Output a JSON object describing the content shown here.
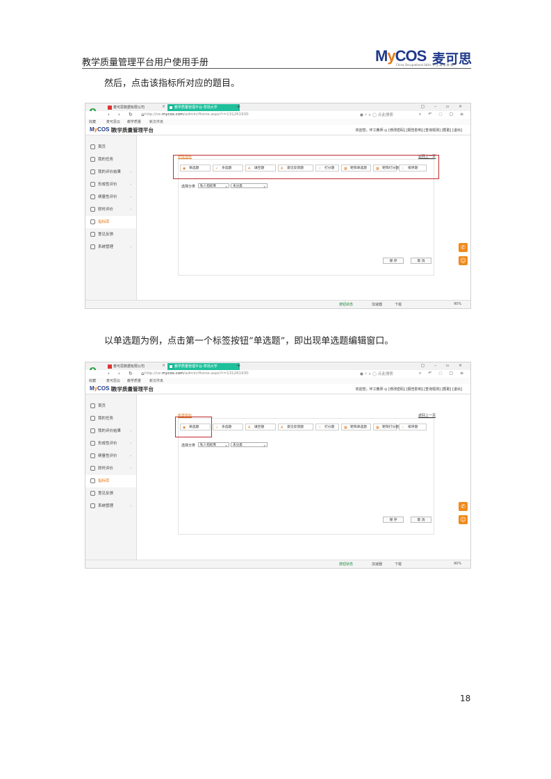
{
  "header": {
    "doc_title": "教学质量管理平台用户使用手册",
    "logo_mark": "MyCOS",
    "logo_cn": "麦可思",
    "logo_sub": "China Occupational Skills  专 注 高 等 教 育"
  },
  "para1": "然后，点击该指标所对应的题目。",
  "para2": "以单选题为例，点击第一个标签按钮“单选题”，即出现单选题编辑窗口。",
  "page_number": "18",
  "browser": {
    "tab1": "麦可思数据有限公司",
    "tab2": "教学质量管理平台-草场大学",
    "url_prefix": "http://ce.",
    "url_domain": "mycos.com",
    "url_path": "/admin/Home.aspx?r=131261930",
    "search_placeholder": "点此搜索",
    "fav_items": [
      "收藏",
      "麦可思云",
      "教学质量",
      "新文件夹"
    ],
    "app_logo": "MyCOS",
    "app_name": "教学质量管理平台",
    "user_links": "欢迎您，环工教师  ◎   [修改密码]  [报告影响]  [查询观测]  [帮助]  [退出]",
    "sidebar": [
      "首页",
      "我的任务",
      "我的评价结果",
      "形成性评价",
      "绩量性评价",
      "即时评价",
      "指标库",
      "意见反馈",
      "系统管理"
    ],
    "section_title": "新建指标",
    "back_link": "返回上一页",
    "question_types": [
      {
        "icon": "◉",
        "label": "单选题"
      },
      {
        "icon": "✓",
        "label": "多选题"
      },
      {
        "icon": "A",
        "label": "填空题"
      },
      {
        "icon": "A",
        "label": "意见反馈题"
      },
      {
        "icon": "☆",
        "label": "打分题"
      },
      {
        "icon": "▦",
        "label": "矩阵单选题"
      },
      {
        "icon": "▦",
        "label": "矩阵打分题"
      },
      {
        "icon": "☝",
        "label": "排序题"
      }
    ],
    "filter_label": "选择分类",
    "select1": "私人指标库",
    "select2": "未分类",
    "save": "保  存",
    "cancel": "取  消",
    "status": [
      "按钮状态",
      "加速器",
      "下载",
      "90%"
    ]
  },
  "colors": {
    "accent": "#e07a1a",
    "brand": "#1f3a8a",
    "highlight": "#c0292a",
    "tab_active": "#1fbf9c"
  }
}
